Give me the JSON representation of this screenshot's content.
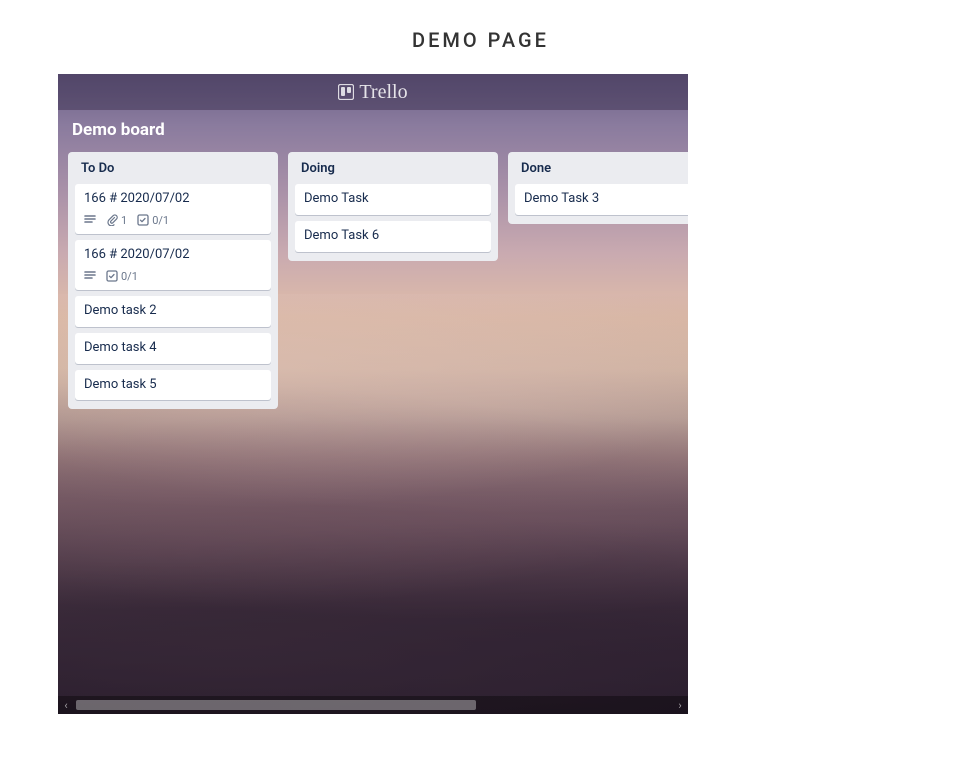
{
  "page_title": "DEMO PAGE",
  "app_name": "Trello",
  "board": {
    "name": "Demo board",
    "lists": [
      {
        "title": "To Do",
        "cards": [
          {
            "title": "166 # 2020/07/02",
            "badges": {
              "description": true,
              "attachments": "1",
              "checklist": "0/1"
            }
          },
          {
            "title": "166 # 2020/07/02",
            "badges": {
              "description": true,
              "checklist": "0/1"
            }
          },
          {
            "title": "Demo task 2"
          },
          {
            "title": "Demo task 4"
          },
          {
            "title": "Demo task 5"
          }
        ]
      },
      {
        "title": "Doing",
        "cards": [
          {
            "title": "Demo Task"
          },
          {
            "title": "Demo Task 6"
          }
        ]
      },
      {
        "title": "Done",
        "cards": [
          {
            "title": "Demo Task 3"
          }
        ]
      }
    ]
  }
}
